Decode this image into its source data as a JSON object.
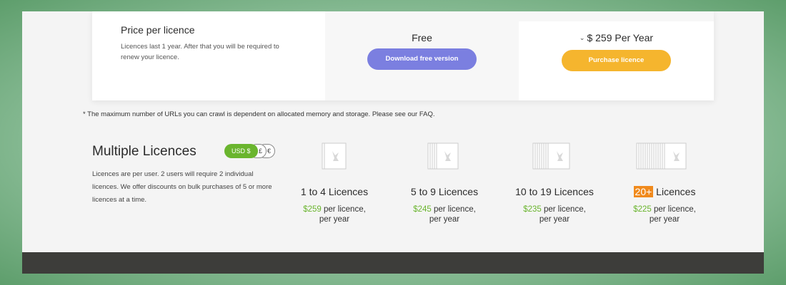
{
  "pricing": {
    "title": "Price per licence",
    "description": "Licences last 1 year. After that you will be required to renew your licence.",
    "free_plan": {
      "name": "Free",
      "button": "Download free version"
    },
    "paid_plan": {
      "currency_chevron": "⌄",
      "price": "$ 259 Per Year",
      "button": "Purchase licence"
    }
  },
  "footnote": "* The maximum number of URLs you can crawl is dependent on allocated memory and storage. Please see our FAQ.",
  "multiple": {
    "title": "Multiple Licences",
    "currency": {
      "active": "USD $",
      "gbp": "£",
      "eur": "€"
    },
    "description": "Licences are per user. 2 users will require 2 individual licences. We offer discounts on bulk purchases of 5 or more licences at a time.",
    "tiers": [
      {
        "name": "1 to 4 Licences",
        "amount": "$259",
        "unit1": " per licence,",
        "unit2": "per year"
      },
      {
        "name": "5 to 9 Licences",
        "amount": "$245",
        "unit1": " per licence,",
        "unit2": "per year"
      },
      {
        "name": "10 to 19 Licences",
        "amount": "$235",
        "unit1": " per licence,",
        "unit2": "per year"
      },
      {
        "highlight": "20+",
        "name": " Licences",
        "amount": "$225",
        "unit1": " per licence,",
        "unit2": "per year"
      }
    ]
  }
}
